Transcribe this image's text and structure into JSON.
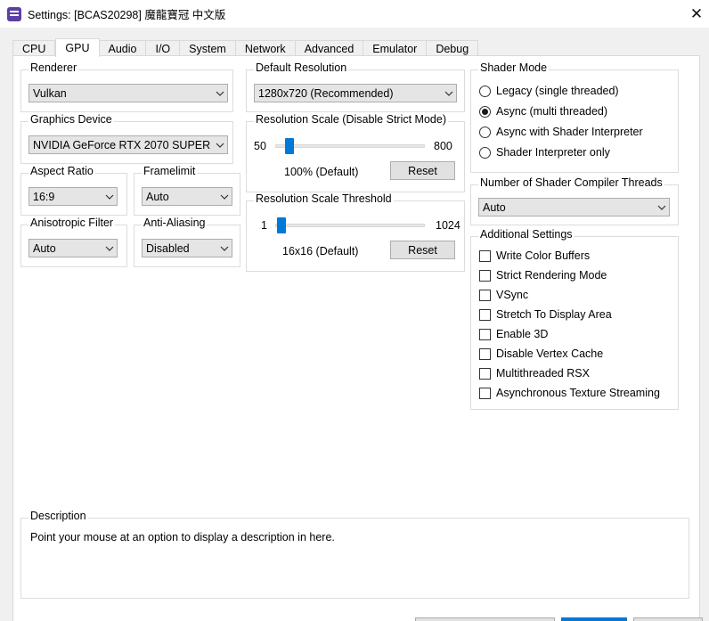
{
  "window": {
    "title": "Settings: [BCAS20298] 魔龍寶冠 中文版",
    "close_glyph": "✕"
  },
  "tabs": [
    {
      "label": "CPU",
      "active": false
    },
    {
      "label": "GPU",
      "active": true
    },
    {
      "label": "Audio",
      "active": false
    },
    {
      "label": "I/O",
      "active": false
    },
    {
      "label": "System",
      "active": false
    },
    {
      "label": "Network",
      "active": false
    },
    {
      "label": "Advanced",
      "active": false
    },
    {
      "label": "Emulator",
      "active": false
    },
    {
      "label": "Debug",
      "active": false
    }
  ],
  "renderer": {
    "title": "Renderer",
    "value": "Vulkan"
  },
  "graphics_device": {
    "title": "Graphics Device",
    "value": "NVIDIA GeForce RTX 2070 SUPER"
  },
  "aspect_ratio": {
    "title": "Aspect Ratio",
    "value": "16:9"
  },
  "framelimit": {
    "title": "Framelimit",
    "value": "Auto"
  },
  "anisotropic_filter": {
    "title": "Anisotropic Filter",
    "value": "Auto"
  },
  "anti_aliasing": {
    "title": "Anti-Aliasing",
    "value": "Disabled"
  },
  "default_resolution": {
    "title": "Default Resolution",
    "value": "1280x720 (Recommended)"
  },
  "resolution_scale": {
    "title": "Resolution Scale (Disable Strict Mode)",
    "min_label": "50",
    "max_label": "800",
    "min": 50,
    "max": 800,
    "value": 100,
    "value_text": "100% (Default)",
    "reset_label": "Reset"
  },
  "resolution_scale_threshold": {
    "title": "Resolution Scale Threshold",
    "min_label": "1",
    "max_label": "1024",
    "min": 1,
    "max": 1024,
    "value": 16,
    "value_text": "16x16 (Default)",
    "reset_label": "Reset"
  },
  "shader_mode": {
    "title": "Shader Mode",
    "options": [
      {
        "label": "Legacy (single threaded)",
        "selected": false
      },
      {
        "label": "Async (multi threaded)",
        "selected": true
      },
      {
        "label": "Async with Shader Interpreter",
        "selected": false
      },
      {
        "label": "Shader Interpreter only",
        "selected": false
      }
    ]
  },
  "shader_compiler_threads": {
    "title": "Number of Shader Compiler Threads",
    "value": "Auto"
  },
  "additional_settings": {
    "title": "Additional Settings",
    "items": [
      {
        "label": "Write Color Buffers",
        "checked": false
      },
      {
        "label": "Strict Rendering Mode",
        "checked": false
      },
      {
        "label": "VSync",
        "checked": false
      },
      {
        "label": "Stretch To Display Area",
        "checked": false
      },
      {
        "label": "Enable 3D",
        "checked": false
      },
      {
        "label": "Disable Vertex Cache",
        "checked": false
      },
      {
        "label": "Multithreaded RSX",
        "checked": false
      },
      {
        "label": "Asynchronous Texture Streaming",
        "checked": false
      }
    ]
  },
  "description": {
    "title": "Description",
    "text": "Point your mouse at an option to display a description in here."
  },
  "colors": {
    "accent": "#0078d7",
    "pane": "#ffffff",
    "chrome": "#f0f0f0"
  }
}
